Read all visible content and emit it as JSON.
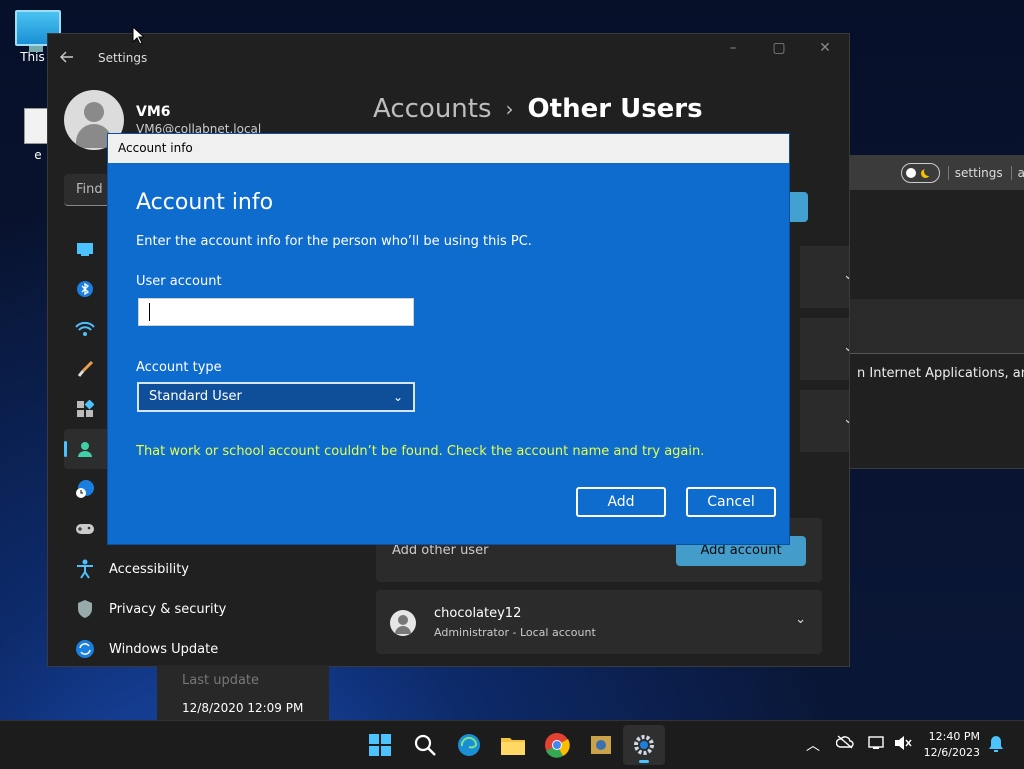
{
  "desktop": {
    "icons": [
      {
        "label": "This P"
      },
      {
        "label": "e"
      }
    ]
  },
  "background_window": {
    "toolbar_text": "settings",
    "toolbar_text2": "a",
    "content_text": "n Internet Applications, and s"
  },
  "settings": {
    "app_title": "Settings",
    "user": {
      "name": "VM6",
      "email": "VM6@collabnet.local"
    },
    "search_placeholder": "Find a",
    "nav": [
      {
        "icon": "monitor-icon",
        "label": ""
      },
      {
        "icon": "bluetooth-icon",
        "label": ""
      },
      {
        "icon": "wifi-icon",
        "label": ""
      },
      {
        "icon": "paintbrush-icon",
        "label": ""
      },
      {
        "icon": "apps-icon",
        "label": ""
      },
      {
        "icon": "accounts-icon",
        "label": ""
      },
      {
        "icon": "time-language-icon",
        "label": ""
      },
      {
        "icon": "gaming-icon",
        "label": ""
      },
      {
        "icon": "accessibility-icon",
        "label": "Accessibility"
      },
      {
        "icon": "shield-icon",
        "label": "Privacy & security"
      },
      {
        "icon": "windows-update-icon",
        "label": "Windows Update"
      }
    ],
    "breadcrumb": {
      "parent": "Accounts",
      "separator": "›",
      "current": "Other Users"
    },
    "add_other_user": {
      "label": "Add other user",
      "button": "Add account"
    },
    "users": [
      {
        "name": "chocolatey12",
        "role": "Administrator - Local account"
      }
    ]
  },
  "background_update": {
    "label": "Last update",
    "date": "12/8/2020 12:09 PM"
  },
  "dialog": {
    "window_title": "Account info",
    "heading": "Account info",
    "description": "Enter the account info for the person who’ll be using this PC.",
    "user_account_label": "User account",
    "user_account_value": "",
    "account_type_label": "Account type",
    "account_type_value": "Standard User",
    "error": "That work or school account couldn’t be found. Check the account name and try again.",
    "add_button": "Add",
    "cancel_button": "Cancel"
  },
  "taskbar": {
    "time": "12:40 PM",
    "date": "12/6/2023"
  },
  "colors": {
    "dialog_bg": "#0f6ccf",
    "accent": "#4cc2ff",
    "error_text": "#e6ff4a",
    "window_bg": "#202020"
  }
}
